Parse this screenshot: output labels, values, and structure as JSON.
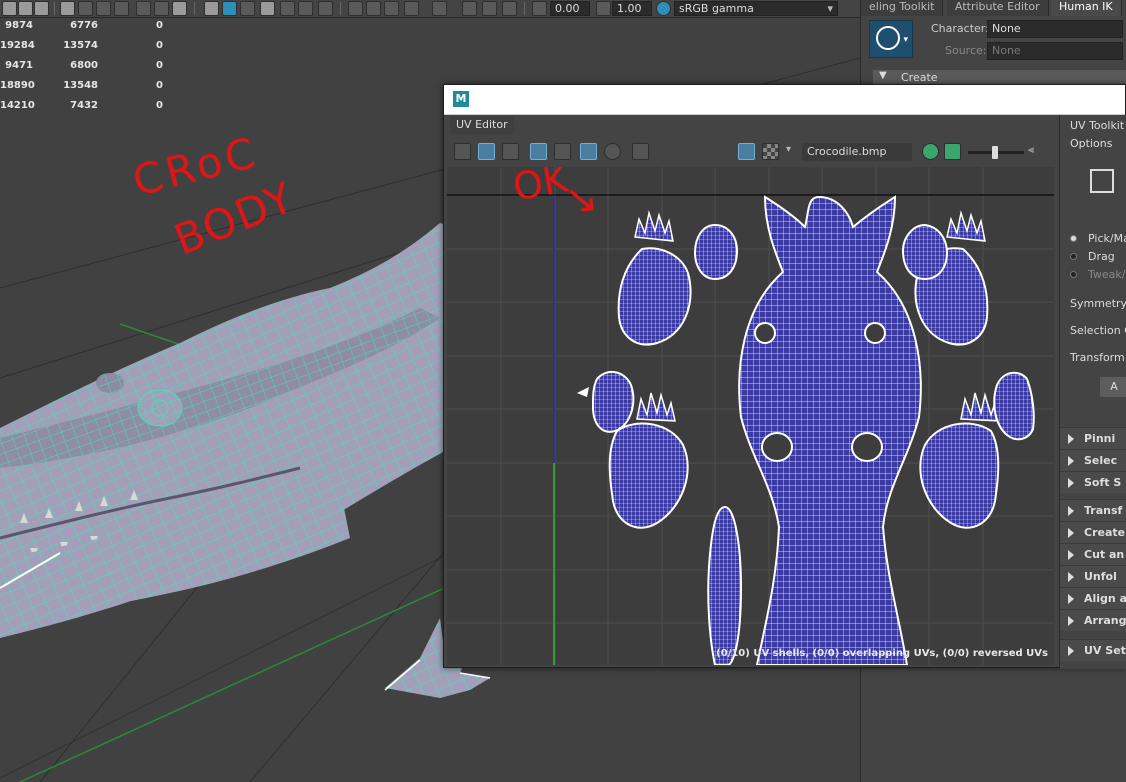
{
  "toolbar": {
    "field_one": "0.00",
    "field_two": "1.00",
    "color_space": "sRGB gamma"
  },
  "hud": {
    "rows": [
      [
        "9874",
        "6776",
        "0"
      ],
      [
        "19284",
        "13574",
        "0"
      ],
      [
        "9471",
        "6800",
        "0"
      ],
      [
        "18890",
        "13548",
        "0"
      ],
      [
        "14210",
        "7432",
        "0"
      ]
    ]
  },
  "annotations": {
    "croc_line1": "CRoC",
    "croc_line2": "BODY",
    "ok": "OK"
  },
  "panel": {
    "tabs": [
      "eling Toolkit",
      "Attribute Editor",
      "Human IK"
    ],
    "character_label": "Character:",
    "character_value": "None",
    "source_label": "Source:",
    "source_value": "None",
    "create_label": "Create"
  },
  "uv_editor": {
    "tab_label": "UV Editor",
    "image_name": "Crocodile.bmp",
    "status": "(0/10) UV shells, (0/0) overlapping UVs, (0/0) reversed UVs"
  },
  "uv_toolkit": {
    "title": "UV Toolkit",
    "options": "Options",
    "pick_mode": "Pick/Ma",
    "drag": "Drag",
    "tweak": "Tweak/",
    "symmetry": "Symmetry:",
    "selection": "Selection C",
    "transform_label": "Transform",
    "button": "A",
    "sections": [
      "Pinni",
      "Selec",
      "Soft S",
      "Transf",
      "Create",
      "Cut an",
      "Unfol",
      "Align a",
      "Arrang",
      "UV Set"
    ]
  },
  "colors": {
    "wire": "#3ce6b4",
    "mesh": "#a39fba",
    "uv_fill": "#3a3aa2",
    "annotation": "#e01515"
  }
}
